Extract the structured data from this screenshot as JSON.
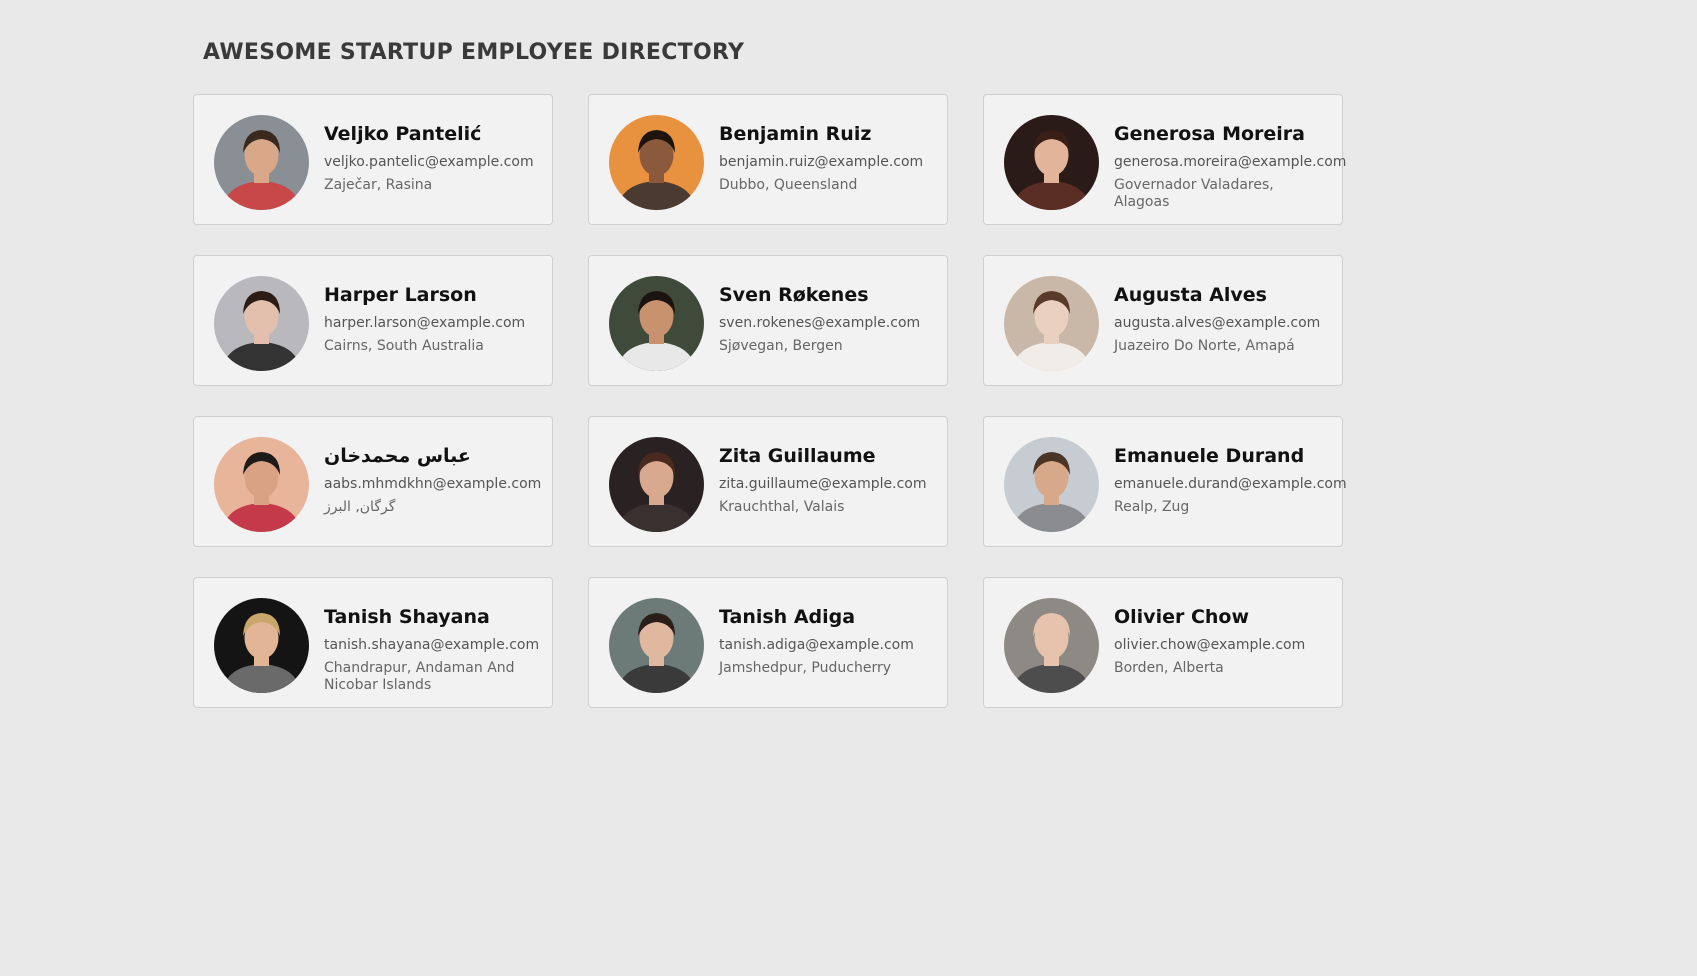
{
  "header": {
    "title": "AWESOME STARTUP EMPLOYEE DIRECTORY"
  },
  "employees": [
    {
      "name": "Veljko Pantelić",
      "email": "veljko.pantelic@example.com",
      "location": "Zaječar, Rasina",
      "avatar": {
        "bg": "#8a8f96",
        "skin": "#d9a888",
        "hair": "#3a2a1e",
        "shirt": "#c8484a"
      }
    },
    {
      "name": "Benjamin Ruiz",
      "email": "benjamin.ruiz@example.com",
      "location": "Dubbo, Queensland",
      "avatar": {
        "bg": "#e8913f",
        "skin": "#8b5a3c",
        "hair": "#1e140e",
        "shirt": "#4a3a30"
      }
    },
    {
      "name": "Generosa Moreira",
      "email": "generosa.moreira@example.com",
      "location": "Governador Valadares, Alagoas",
      "avatar": {
        "bg": "#2b1b18",
        "skin": "#e2b49a",
        "hair": "#3a1f17",
        "shirt": "#5a2e24"
      }
    },
    {
      "name": "Harper Larson",
      "email": "harper.larson@example.com",
      "location": "Cairns, South Australia",
      "avatar": {
        "bg": "#b9b9bd",
        "skin": "#e3c0ad",
        "hair": "#2b1c16",
        "shirt": "#333333"
      }
    },
    {
      "name": "Sven Røkenes",
      "email": "sven.rokenes@example.com",
      "location": "Sjøvegan, Bergen",
      "avatar": {
        "bg": "#3f4a3a",
        "skin": "#c8926e",
        "hair": "#1c1410",
        "shirt": "#e8e8e8"
      }
    },
    {
      "name": "Augusta Alves",
      "email": "augusta.alves@example.com",
      "location": "Juazeiro Do Norte, Amapá",
      "avatar": {
        "bg": "#c9b7a8",
        "skin": "#ead0bf",
        "hair": "#5a3a28",
        "shirt": "#f0ece8"
      }
    },
    {
      "name": "عباس محمدخان",
      "email": "aabs.mhmdkhn@example.com",
      "location": "گرگان, البرز",
      "avatar": {
        "bg": "#e8b49a",
        "skin": "#d9a284",
        "hair": "#1e1a18",
        "shirt": "#c43a4a"
      }
    },
    {
      "name": "Zita Guillaume",
      "email": "zita.guillaume@example.com",
      "location": "Krauchthal, Valais",
      "avatar": {
        "bg": "#2a2222",
        "skin": "#d8a98e",
        "hair": "#4a2a1e",
        "shirt": "#3a3030"
      }
    },
    {
      "name": "Emanuele Durand",
      "email": "emanuele.durand@example.com",
      "location": "Realp, Zug",
      "avatar": {
        "bg": "#c7ccd2",
        "skin": "#d7a98a",
        "hair": "#4a3526",
        "shirt": "#8a8c90"
      }
    },
    {
      "name": "Tanish Shayana",
      "email": "tanish.shayana@example.com",
      "location": "Chandrapur, Andaman And Nicobar Islands",
      "avatar": {
        "bg": "#141414",
        "skin": "#e2b597",
        "hair": "#c9a66a",
        "shirt": "#6a6a6a"
      }
    },
    {
      "name": "Tanish Adiga",
      "email": "tanish.adiga@example.com",
      "location": "Jamshedpur, Puducherry",
      "avatar": {
        "bg": "#6c7a78",
        "skin": "#e0b8a0",
        "hair": "#2a1e18",
        "shirt": "#3a3a3a"
      }
    },
    {
      "name": "Olivier Chow",
      "email": "olivier.chow@example.com",
      "location": "Borden, Alberta",
      "avatar": {
        "bg": "#8d8a86",
        "skin": "#e7c2ac",
        "hair": "#e7c2ac",
        "shirt": "#4d4d4d"
      }
    }
  ]
}
